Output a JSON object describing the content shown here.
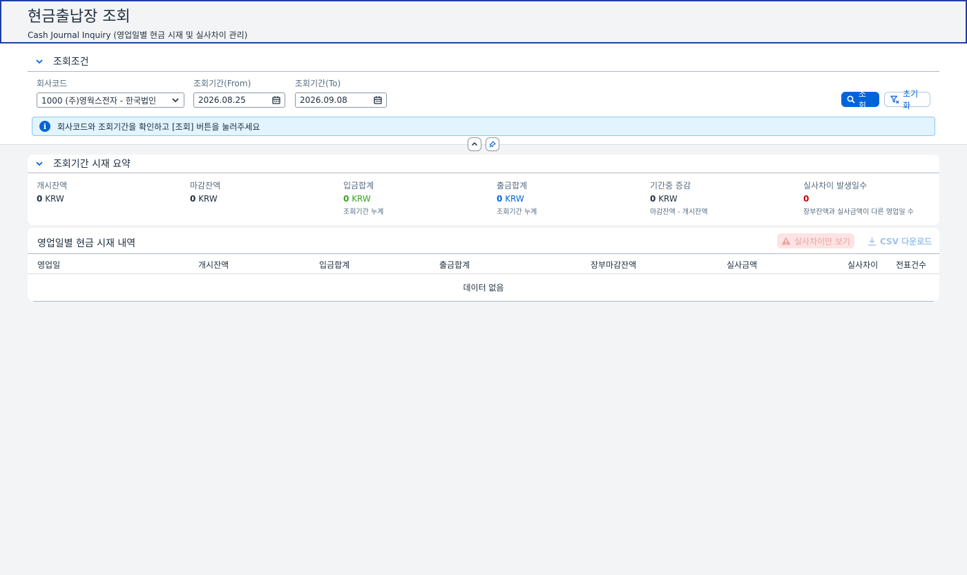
{
  "header": {
    "title": "현금출납장 조회",
    "subtitle": "Cash Journal Inquiry (영업일별 현금 시재 및 실사차이 관리)"
  },
  "filters": {
    "section_title": "조회조건",
    "company_label": "회사코드",
    "company_value": "1000 (주)영웍스전자 - 한국법인",
    "from_label": "조회기간(From)",
    "from_value": "2026.08.25",
    "to_label": "조회기간(To)",
    "to_value": "2026.09.08",
    "search_button": "조회",
    "reset_button": "초기화",
    "message": "회사코드와 조회기간을 확인하고 [조회] 버튼을 눌러주세요"
  },
  "summary": {
    "section_title": "조회기간 시재 요약",
    "items": [
      {
        "label": "개시잔액",
        "value": "0",
        "unit": "KRW",
        "sub": ""
      },
      {
        "label": "마감잔액",
        "value": "0",
        "unit": "KRW",
        "sub": ""
      },
      {
        "label": "입금합계",
        "value": "0",
        "unit": "KRW",
        "sub": "조회기간 누계"
      },
      {
        "label": "출금합계",
        "value": "0",
        "unit": "KRW",
        "sub": "조회기간 누계"
      },
      {
        "label": "기간중 증감",
        "value": "0",
        "unit": "KRW",
        "sub": "마감잔액 - 개시잔액"
      },
      {
        "label": "실사차이 발생일수",
        "value": "0",
        "unit": "",
        "sub": "장부잔액과 실사금액이 다른 영업일 수"
      }
    ],
    "colors": {
      "neutral": "#1d2d3e",
      "deposit": "#36a41d",
      "withdraw": "#0064d9",
      "diff": "#c80000"
    }
  },
  "table": {
    "title": "영업일별 현금 시재 내역",
    "diff_only_button": "실사차이만 보기",
    "csv_button": "CSV 다운로드",
    "columns": [
      "영업일",
      "개시잔액",
      "입금합계",
      "출금합계",
      "장부마감잔액",
      "실사금액",
      "실사차이",
      "전표건수"
    ],
    "empty_text": "데이터 없음"
  },
  "accent": "#0064d9"
}
